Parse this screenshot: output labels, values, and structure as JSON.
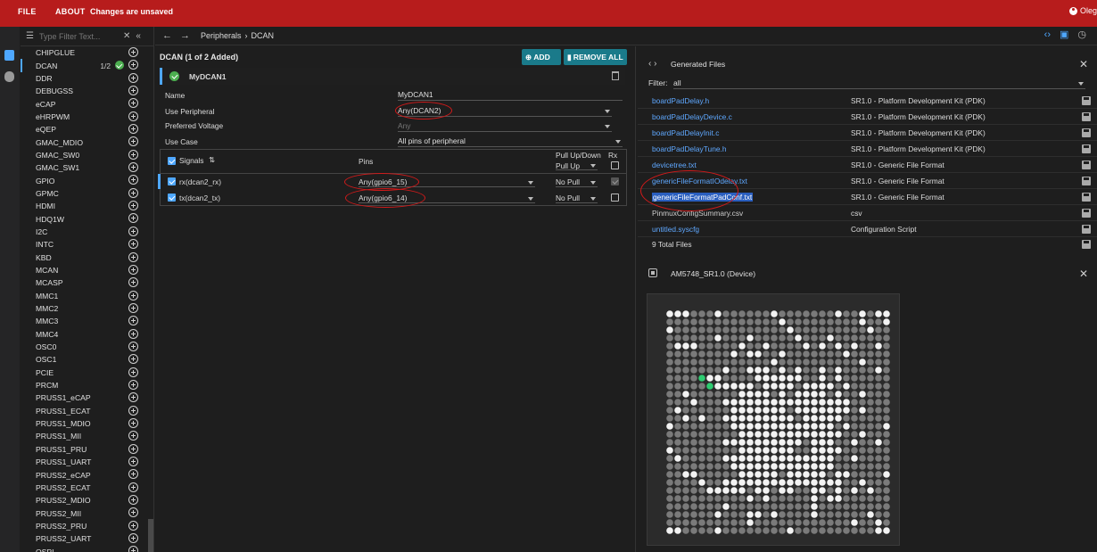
{
  "topbar": {
    "file_label": "FILE",
    "about_label": "ABOUT",
    "status": "Changes are unsaved",
    "user": "Oleg"
  },
  "sidebar": {
    "filter_placeholder": "Type Filter Text...",
    "items": [
      {
        "label": "CHIPGLUE"
      },
      {
        "label": "DCAN",
        "count": "1/2",
        "ok": true,
        "active": true
      },
      {
        "label": "DDR"
      },
      {
        "label": "DEBUGSS"
      },
      {
        "label": "eCAP"
      },
      {
        "label": "eHRPWM"
      },
      {
        "label": "eQEP"
      },
      {
        "label": "GMAC_MDIO"
      },
      {
        "label": "GMAC_SW0"
      },
      {
        "label": "GMAC_SW1"
      },
      {
        "label": "GPIO"
      },
      {
        "label": "GPMC"
      },
      {
        "label": "HDMI"
      },
      {
        "label": "HDQ1W"
      },
      {
        "label": "I2C"
      },
      {
        "label": "INTC"
      },
      {
        "label": "KBD"
      },
      {
        "label": "MCAN"
      },
      {
        "label": "MCASP"
      },
      {
        "label": "MMC1"
      },
      {
        "label": "MMC2"
      },
      {
        "label": "MMC3"
      },
      {
        "label": "MMC4"
      },
      {
        "label": "OSC0"
      },
      {
        "label": "OSC1"
      },
      {
        "label": "PCIE"
      },
      {
        "label": "PRCM"
      },
      {
        "label": "PRUSS1_eCAP"
      },
      {
        "label": "PRUSS1_ECAT"
      },
      {
        "label": "PRUSS1_MDIO"
      },
      {
        "label": "PRUSS1_MII"
      },
      {
        "label": "PRUSS1_PRU"
      },
      {
        "label": "PRUSS1_UART"
      },
      {
        "label": "PRUSS2_eCAP"
      },
      {
        "label": "PRUSS2_ECAT"
      },
      {
        "label": "PRUSS2_MDIO"
      },
      {
        "label": "PRUSS2_MII"
      },
      {
        "label": "PRUSS2_PRU"
      },
      {
        "label": "PRUSS2_UART"
      },
      {
        "label": "QSPI"
      }
    ]
  },
  "breadcrumb": {
    "items": [
      "Peripherals",
      "DCAN"
    ],
    "separator": "›"
  },
  "panel": {
    "title": "DCAN (1 of 2 Added)",
    "add_label": "ADD",
    "remove_all_label": "REMOVE ALL",
    "instance_name": "MyDCAN1",
    "fields": {
      "name_label": "Name",
      "name_value": "MyDCAN1",
      "use_peripheral_label": "Use Peripheral",
      "use_peripheral_value": "Any(DCAN2)",
      "pref_voltage_label": "Preferred Voltage",
      "pref_voltage_value": "Any",
      "use_case_label": "Use Case",
      "use_case_value": "All pins of peripheral"
    },
    "signals": {
      "header_signals": "Signals",
      "header_pins": "Pins",
      "header_pull": "Pull Up/Down",
      "header_pull_value": "Pull Up",
      "header_rx": "Rx",
      "rows": [
        {
          "signal": "rx(dcan2_rx)",
          "pin": "Any(gpio6_15)",
          "pull": "No Pull",
          "rx_checked": true,
          "rx_disabled": true
        },
        {
          "signal": "tx(dcan2_tx)",
          "pin": "Any(gpio6_14)",
          "pull": "No Pull",
          "rx_checked": false,
          "rx_disabled": false
        }
      ]
    }
  },
  "files": {
    "title": "Generated Files",
    "filter_label": "Filter:",
    "filter_value": "all",
    "rows": [
      {
        "name": "boardPadDelay.h",
        "type": "SR1.0 - Platform Development Kit (PDK)"
      },
      {
        "name": "boardPadDelayDevice.c",
        "type": "SR1.0 - Platform Development Kit (PDK)"
      },
      {
        "name": "boardPadDelayInit.c",
        "type": "SR1.0 - Platform Development Kit (PDK)"
      },
      {
        "name": "boardPadDelayTune.h",
        "type": "SR1.0 - Platform Development Kit (PDK)"
      },
      {
        "name": "devicetree.txt",
        "type": "SR1.0 - Generic File Format"
      },
      {
        "name": "genericFileFormatIOdelay.txt",
        "type": "SR1.0 - Generic File Format"
      },
      {
        "name": "genericFileFormatPadConf.txt",
        "type": "SR1.0 - Generic File Format",
        "selected": true
      },
      {
        "name": "PinmuxConfigSummary.csv",
        "type": "csv",
        "plain": true
      },
      {
        "name": "untitled.syscfg",
        "type": "Configuration Script"
      }
    ],
    "total": "9 Total Files"
  },
  "device": {
    "title": "AM5748_SR1.0 (Device)"
  },
  "colors": {
    "accent": "#b71c1c",
    "button": "#1a7a8a",
    "link": "#5fa8ff",
    "ok": "#4caf50",
    "annotation": "#d21a1a"
  }
}
